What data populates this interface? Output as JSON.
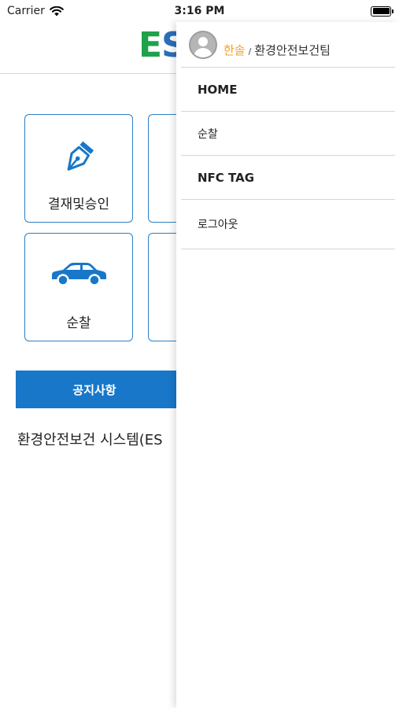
{
  "status": {
    "carrier": "Carrier",
    "time": "3:16 PM"
  },
  "app": {
    "logo_e": "E",
    "logo_s": "S",
    "tiles": [
      {
        "label": "결재및승인",
        "icon": "pen-nib-icon"
      },
      {
        "label": "순찰",
        "icon": "car-icon"
      }
    ],
    "notice_label": "공지사항",
    "system_text": "환경안전보건 시스템(ES"
  },
  "drawer": {
    "user_name": "한솔",
    "separator": "/",
    "team": "환경안전보건팀",
    "items": [
      {
        "label": "HOME"
      },
      {
        "label": "순찰"
      },
      {
        "label": "NFC TAG"
      },
      {
        "label": "로그아웃"
      }
    ]
  },
  "colors": {
    "accent_blue": "#1877c9",
    "tile_border": "#2d7fc3",
    "logo_green": "#1fa24a",
    "user_orange": "#f0a22a"
  }
}
